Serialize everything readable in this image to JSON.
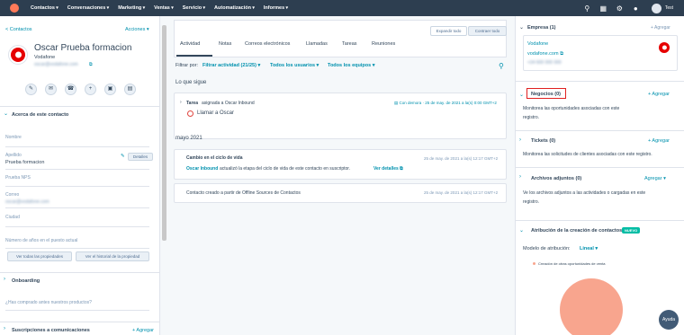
{
  "nav": {
    "items": [
      "Contactos",
      "Conversaciones",
      "Marketing",
      "Ventas",
      "Servicio",
      "Automatización",
      "Informes"
    ],
    "user": "Test"
  },
  "left": {
    "back": "< Contactos",
    "actions": "Acciones",
    "name": "Oscar Prueba formacion",
    "company": "Vodafone",
    "email": "oscar@vodafone.com",
    "section_about": "Acerca de este contacto",
    "fields": [
      {
        "label": "Nombre",
        "value": ""
      },
      {
        "label": "Apellido",
        "value": "Prueba formacion"
      },
      {
        "label": "Prueba NPS",
        "value": ""
      },
      {
        "label": "Correo",
        "value": "oscar@vodafone.com"
      },
      {
        "label": "Ciudad",
        "value": ""
      },
      {
        "label": "Número de años en el puesto actual",
        "value": ""
      }
    ],
    "details_btn": "Detalles",
    "btn_all_props": "Ver todas las propiedades",
    "btn_history": "Ver el historial de la propiedad",
    "onboarding": "Onboarding",
    "onboarding_q": "¿Has comprado antes nuestros productos?",
    "subscriptions": "Suscripciones a comunicaciones",
    "add": "+ Agregar"
  },
  "mid": {
    "tabs": [
      "Actividad",
      "Notas",
      "Correos electrónicos",
      "Llamadas",
      "Tareas",
      "Reuniones"
    ],
    "expand": "Expandir todo",
    "collapse": "Contraer todo",
    "filter_label": "Filtrar por:",
    "filter_activity": "Filtrar actividad (21/25)",
    "filter_users": "Todos los usuarios",
    "filter_teams": "Todos los equipos",
    "next_title": "Lo que sigue",
    "task_label": "Tarea",
    "task_assigned": "asignada a Oscar Inbound",
    "task_date": "Con demora · 25 de may. de 2021 a la(s) 0:00 GMT+2",
    "task_title": "Llamar a Oscar",
    "month": "mayo 2021",
    "item1_title": "Cambio en el ciclo de vida",
    "item1_date": "25 de may. de 2021 a la(s) 12:17 GMT+2",
    "item1_user": "Oscar Inbound",
    "item1_text": "actualizó la etapa del ciclo de vida de este contacto en suscriptor.",
    "item1_link": "Ver detalles",
    "item2_text": "Contacto creado a partir de Offline Sources de Contactos",
    "item2_date": "25 de may. de 2021 a la(s) 12:17 GMT+2"
  },
  "right": {
    "empresa_title": "Empresa (1)",
    "empresa_add": "+ Agregar",
    "company_name": "Vodafone",
    "company_url": "vodafone.com",
    "company_phone": "+34 600 000 000",
    "negocios_title": "Negocios (0)",
    "negocios_add": "+ Agregar",
    "negocios_desc1": "Monitorea las oportunidades asociadas con este",
    "negocios_desc2": "registro.",
    "tickets_title": "Tickets (0)",
    "tickets_add": "+ Agregar",
    "tickets_desc": "Monitorea las solicitudes de clientes asociadas con este registro.",
    "archivos_title": "Archivos adjuntos (0)",
    "archivos_add": "Agregar",
    "archivos_desc1": "Ve los archivos adjuntos a las actividades o cargadas en este",
    "archivos_desc2": "registro.",
    "atribucion_title": "Atribución de la creación de contactos",
    "badge_new": "NUEVO",
    "model_label": "Modelo de atribución:",
    "model_value": "Lineal",
    "legend": "Creación de otras oportunidades de venta",
    "pie_color": "#f8a58e"
  },
  "help": "Ayuda"
}
